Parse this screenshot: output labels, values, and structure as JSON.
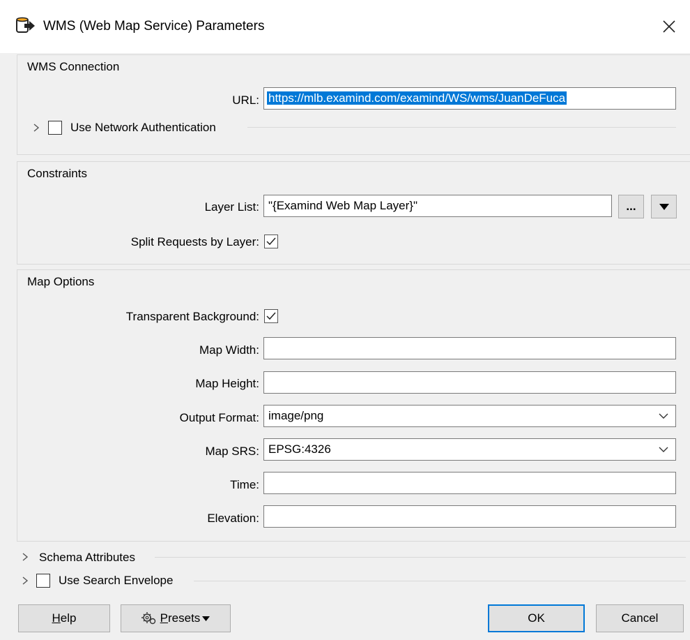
{
  "window": {
    "title": "WMS (Web Map Service) Parameters",
    "icon": "reader-arrow-icon"
  },
  "connection": {
    "group_title": "WMS Connection",
    "url_label": "URL:",
    "url_value": "https://mlb.examind.com/examind/WS/wms/JuanDeFuca",
    "auth_label": "Use Network Authentication",
    "auth_checked": false
  },
  "constraints": {
    "group_title": "Constraints",
    "layer_list_label": "Layer List:",
    "layer_list_value": "\"{Examind Web Map Layer}\"",
    "ellipsis_label": "...",
    "split_label": "Split Requests by Layer:",
    "split_checked": true
  },
  "map_options": {
    "group_title": "Map Options",
    "transparent_label": "Transparent Background:",
    "transparent_checked": true,
    "width_label": "Map Width:",
    "width_value": "",
    "height_label": "Map Height:",
    "height_value": "",
    "format_label": "Output Format:",
    "format_value": "image/png",
    "srs_label": "Map SRS:",
    "srs_value": "EPSG:4326",
    "time_label": "Time:",
    "time_value": "",
    "elevation_label": "Elevation:",
    "elevation_value": ""
  },
  "sections": {
    "schema_label": "Schema Attributes",
    "search_envelope_label": "Use Search Envelope",
    "search_envelope_checked": false
  },
  "buttons": {
    "help_mnemonic": "H",
    "help_rest": "elp",
    "presets_mnemonic": "P",
    "presets_rest": "resets",
    "ok": "OK",
    "cancel": "Cancel"
  }
}
